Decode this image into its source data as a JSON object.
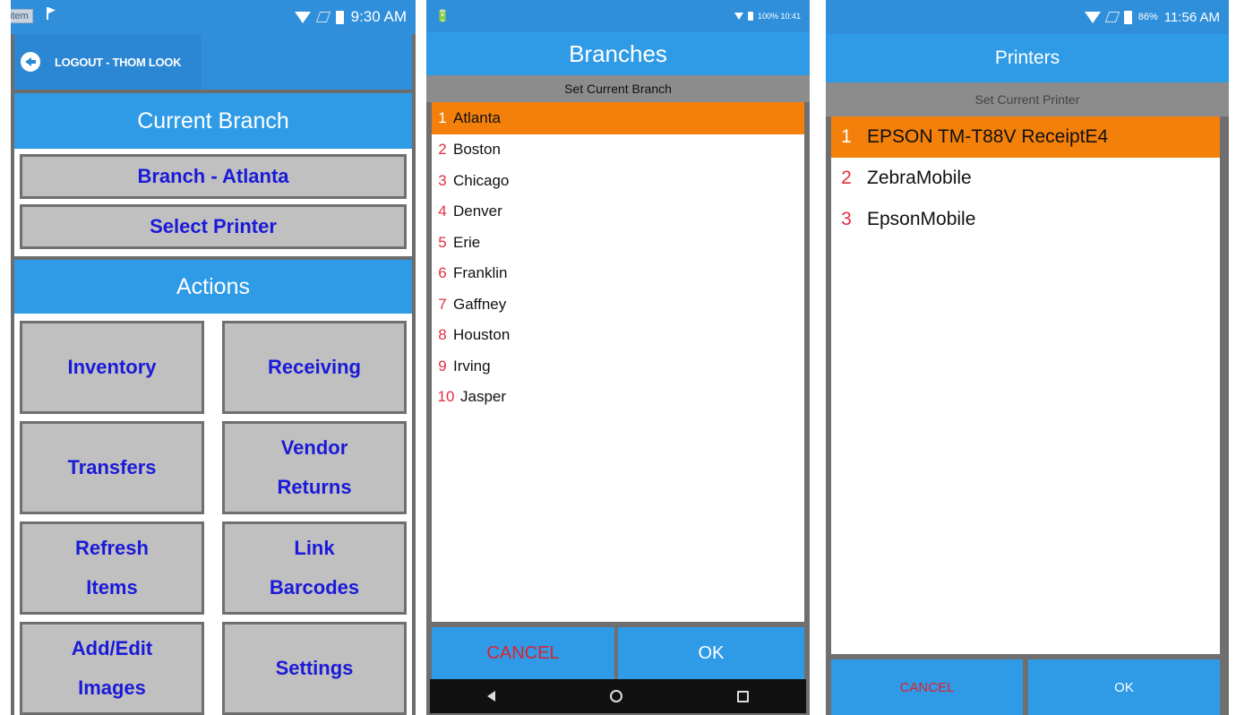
{
  "screen_main": {
    "status_time": "9:30 AM",
    "item_tag": "item",
    "logout_label": "LOGOUT - THOM LOOK",
    "current_branch_header": "Current Branch",
    "branch_button": "Branch - Atlanta",
    "select_printer_button": "Select Printer",
    "actions_header": "Actions",
    "actions": [
      {
        "line1": "Inventory",
        "line2": ""
      },
      {
        "line1": "Receiving",
        "line2": ""
      },
      {
        "line1": "Transfers",
        "line2": ""
      },
      {
        "line1": "Vendor",
        "line2": "Returns"
      },
      {
        "line1": "Refresh",
        "line2": "Items"
      },
      {
        "line1": "Link",
        "line2": "Barcodes"
      },
      {
        "line1": "Add/Edit",
        "line2": "Images"
      },
      {
        "line1": "Settings",
        "line2": ""
      }
    ]
  },
  "screen_branches": {
    "status_text": "100% 10:41",
    "title": "Branches",
    "subtitle": "Set Current Branch",
    "items": [
      {
        "num": "1",
        "label": "Atlanta",
        "selected": true
      },
      {
        "num": "2",
        "label": "Boston"
      },
      {
        "num": "3",
        "label": "Chicago"
      },
      {
        "num": "4",
        "label": "Denver"
      },
      {
        "num": "5",
        "label": "Erie"
      },
      {
        "num": "6",
        "label": "Franklin"
      },
      {
        "num": "7",
        "label": "Gaffney"
      },
      {
        "num": "8",
        "label": "Houston"
      },
      {
        "num": "9",
        "label": "Irving"
      },
      {
        "num": "10",
        "label": "Jasper"
      }
    ],
    "cancel_label": "CANCEL",
    "ok_label": "OK"
  },
  "screen_printers": {
    "status_battery": "86%",
    "status_time": "11:56 AM",
    "title": "Printers",
    "subtitle": "Set Current Printer",
    "items": [
      {
        "num": "1",
        "label": "EPSON TM-T88V ReceiptE4",
        "selected": true
      },
      {
        "num": "2",
        "label": "ZebraMobile"
      },
      {
        "num": "3",
        "label": "EpsonMobile"
      }
    ],
    "cancel_label": "CANCEL",
    "ok_label": "OK"
  },
  "colors": {
    "header_blue": "#2f9be6",
    "selected_orange": "#f2800a",
    "button_text_blue": "#1a1ad8",
    "cancel_red": "#e0202e",
    "number_red": "#e03040"
  }
}
